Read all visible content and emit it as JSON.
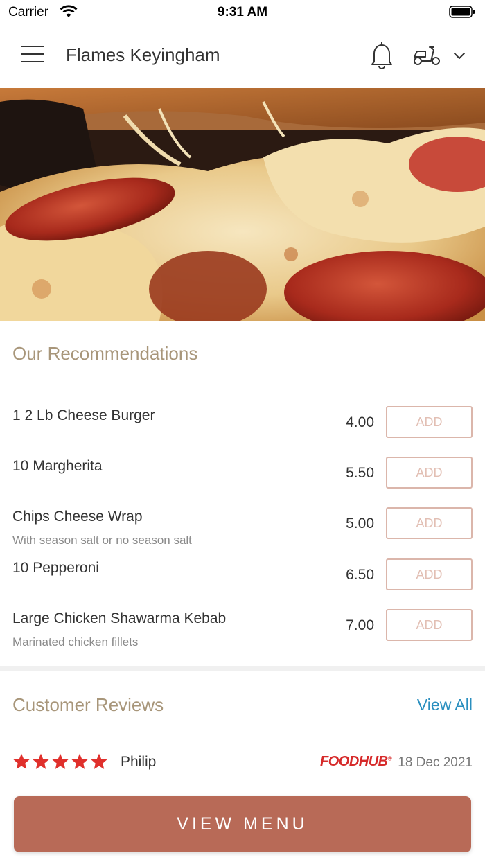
{
  "status_bar": {
    "carrier": "Carrier",
    "time": "9:31 AM"
  },
  "header": {
    "title": "Flames Keyingham"
  },
  "recommendations": {
    "title": "Our Recommendations",
    "items": [
      {
        "name": "1 2 Lb Cheese Burger",
        "description": "",
        "price": "4.00",
        "add_label": "ADD"
      },
      {
        "name": "10 Margherita",
        "description": "",
        "price": "5.50",
        "add_label": "ADD"
      },
      {
        "name": "Chips Cheese Wrap",
        "description": "With season salt or no season salt",
        "price": "5.00",
        "add_label": "ADD"
      },
      {
        "name": "10 Pepperoni",
        "description": "",
        "price": "6.50",
        "add_label": "ADD"
      },
      {
        "name": "Large Chicken Shawarma Kebab",
        "description": "Marinated chicken fillets",
        "price": "7.00",
        "add_label": "ADD"
      }
    ]
  },
  "reviews": {
    "title": "Customer Reviews",
    "view_all": "View All",
    "items": [
      {
        "rating": 5,
        "reviewer": "Philip",
        "source": "FOODHUB",
        "date": "18 Dec 2021"
      }
    ]
  },
  "footer": {
    "view_menu": "VIEW MENU"
  },
  "colors": {
    "accent": "#b86a57",
    "section_title": "#a8967a",
    "add_border": "#dbb6ab",
    "link": "#2a8fbf",
    "star": "#e0302c"
  },
  "icons": [
    "wifi-icon",
    "battery-icon",
    "hamburger-menu-icon",
    "bell-icon",
    "scooter-icon",
    "chevron-down-icon",
    "star-icon"
  ]
}
